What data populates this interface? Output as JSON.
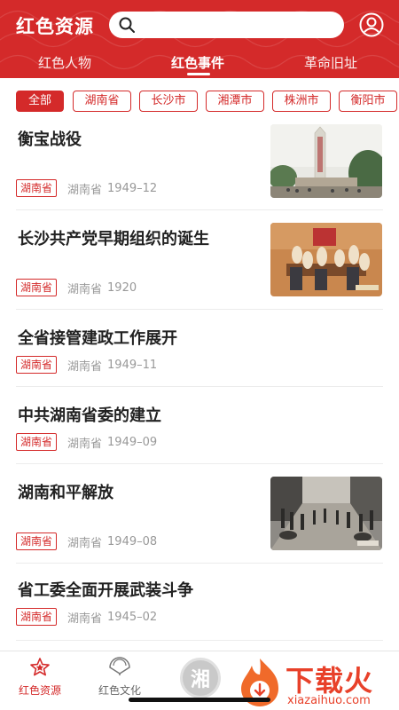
{
  "header": {
    "app_title": "红色资源",
    "search_placeholder": "",
    "tabs": [
      {
        "label": "红色人物",
        "active": false
      },
      {
        "label": "红色事件",
        "active": true
      },
      {
        "label": "革命旧址",
        "active": false
      }
    ]
  },
  "filters": {
    "chips": [
      {
        "label": "全部",
        "active": true
      },
      {
        "label": "湖南省",
        "active": false
      },
      {
        "label": "长沙市",
        "active": false
      },
      {
        "label": "湘潭市",
        "active": false
      },
      {
        "label": "株洲市",
        "active": false
      },
      {
        "label": "衡阳市",
        "active": false
      }
    ]
  },
  "events": [
    {
      "title": "衡宝战役",
      "tag": "湖南省",
      "place": "湖南省",
      "date": "1949–12",
      "has_image": true,
      "image": "monument-photo"
    },
    {
      "title": "长沙共产党早期组织的诞生",
      "tag": "湖南省",
      "place": "湖南省",
      "date": "1920",
      "has_image": true,
      "image": "meeting-painting"
    },
    {
      "title": "全省接管建政工作展开",
      "tag": "湖南省",
      "place": "湖南省",
      "date": "1949–11",
      "has_image": false
    },
    {
      "title": "中共湖南省委的建立",
      "tag": "湖南省",
      "place": "湖南省",
      "date": "1949–09",
      "has_image": false
    },
    {
      "title": "湖南和平解放",
      "tag": "湖南省",
      "place": "湖南省",
      "date": "1949–08",
      "has_image": true,
      "image": "parade-photo"
    },
    {
      "title": "省工委全面开展武装斗争",
      "tag": "湖南省",
      "place": "湖南省",
      "date": "1945–02",
      "has_image": false
    }
  ],
  "bottom_nav": {
    "items": [
      {
        "label": "红色资源",
        "icon": "star-icon",
        "active": true
      },
      {
        "label": "红色文化",
        "icon": "fan-icon",
        "active": false
      }
    ],
    "center_label": "湘"
  },
  "watermark": {
    "main": "下载火",
    "sub": "xiazaihuo.com"
  },
  "colors": {
    "accent": "#d42a2a",
    "muted": "#999999",
    "text": "#222222"
  }
}
